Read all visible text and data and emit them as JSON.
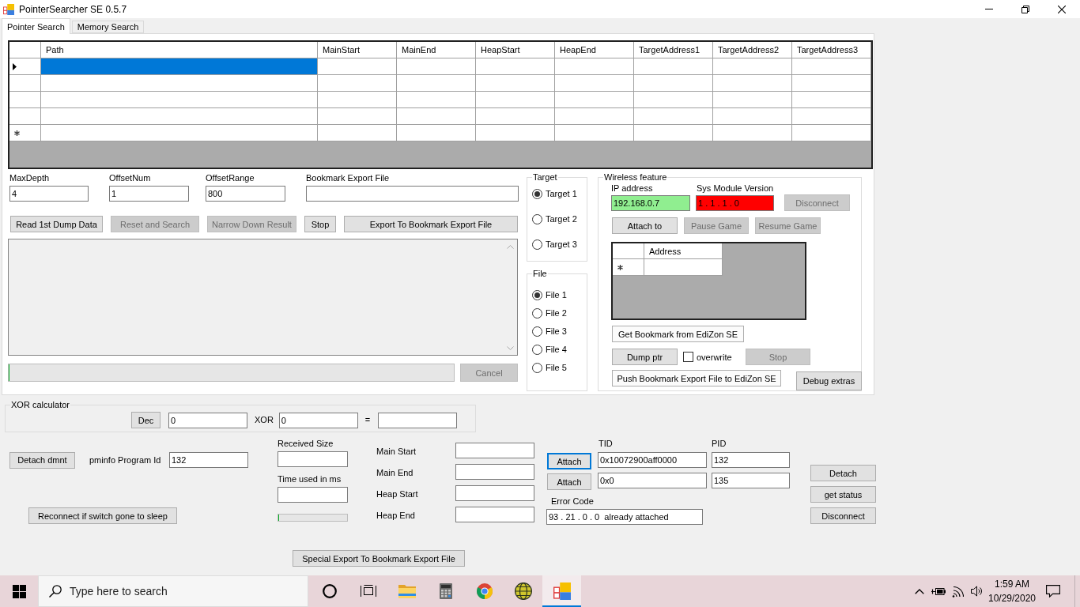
{
  "window": {
    "title": "PointerSearcher SE 0.5.7"
  },
  "tabs": [
    {
      "label": "Pointer Search",
      "selected": true
    },
    {
      "label": "Memory Search",
      "selected": false
    }
  ],
  "results_table": {
    "columns": [
      "Path",
      "MainStart",
      "MainEnd",
      "HeapStart",
      "HeapEnd",
      "TargetAddress1",
      "TargetAddress2",
      "TargetAddress3"
    ],
    "rows": [
      {
        "kind": "data",
        "current": true,
        "selected": true
      },
      {
        "kind": "data",
        "current": false,
        "selected": false
      },
      {
        "kind": "data",
        "current": false,
        "selected": false
      },
      {
        "kind": "data",
        "current": false,
        "selected": false
      },
      {
        "kind": "new",
        "current": false,
        "selected": false
      }
    ]
  },
  "search_fields": [
    {
      "label": "MaxDepth",
      "value": "4"
    },
    {
      "label": "OffsetNum",
      "value": "1"
    },
    {
      "label": "OffsetRange",
      "value": "800"
    },
    {
      "label": "Bookmark Export File"
    }
  ],
  "search_buttons": [
    {
      "label": "Read 1st Dump Data",
      "disabled": false
    },
    {
      "label": "Reset and Search",
      "disabled": true
    },
    {
      "label": "Narrow Down Result",
      "disabled": true
    },
    {
      "label": "Stop",
      "disabled": false
    },
    {
      "label": "Export To Bookmark Export File",
      "disabled": false
    }
  ],
  "search_progress": {
    "level": 0
  },
  "cancel_button": {
    "label": "Cancel",
    "disabled": true
  },
  "target_group": {
    "title": "Target",
    "options": [
      {
        "label": "Target 1",
        "selected": true
      },
      {
        "label": "Target 2",
        "selected": false
      },
      {
        "label": "Target 3",
        "selected": false
      }
    ]
  },
  "file_group": {
    "title": "File",
    "options": [
      {
        "label": "File 1",
        "selected": true
      },
      {
        "label": "File 2",
        "selected": false
      },
      {
        "label": "File 3",
        "selected": false
      },
      {
        "label": "File 4",
        "selected": false
      },
      {
        "label": "File 5",
        "selected": false
      }
    ]
  },
  "wireless": {
    "title": "Wireless feature",
    "fields": [
      {
        "label": "IP address",
        "value": "192.168.0.7",
        "color": "#90ee90"
      },
      {
        "label": "Sys Module Version",
        "value": "1 . 1 . 1 . 0",
        "color": "#ff0000"
      }
    ],
    "disconnect_button": {
      "label": "Disconnect",
      "disabled": true
    },
    "game_buttons": [
      {
        "label": "Attach to",
        "disabled": false
      },
      {
        "label": "Pause Game",
        "disabled": true
      },
      {
        "label": "Resume Game",
        "disabled": true
      }
    ],
    "address_table": {
      "columns": [
        "Address"
      ],
      "rows": [
        {
          "kind": "new"
        }
      ]
    },
    "get_bookmark_button": {
      "label": "Get Bookmark from EdiZon SE"
    },
    "dump_button": {
      "label": "Dump ptr",
      "disabled": false
    },
    "overwrite": {
      "label": "overwrite",
      "checked": false
    },
    "stop_button": {
      "label": "Stop",
      "disabled": true
    },
    "push_button": {
      "label": "Push Bookmark Export File to EdiZon SE"
    },
    "debug_button": {
      "label": "Debug extras"
    }
  },
  "xor_calculator": {
    "title": "XOR calculator",
    "base_button": "Dec",
    "left_value": "0",
    "operator": "XOR",
    "right_value": "0",
    "equals": "="
  },
  "dmnt": {
    "detach_button": "Detach dmnt",
    "program_id_label": "pminfo Program Id",
    "program_id": "132",
    "reconnect_button": "Reconnect if switch gone to sleep"
  },
  "transfer": {
    "received_label": "Received Size",
    "time_label": "Time used in ms",
    "progress": {
      "level": 0
    }
  },
  "regions": [
    {
      "label": "Main Start"
    },
    {
      "label": "Main End"
    },
    {
      "label": "Heap Start"
    },
    {
      "label": "Heap End"
    }
  ],
  "special_export_button": "Special Export To Bookmark Export File",
  "attach": {
    "tid_label": "TID",
    "pid_label": "PID",
    "rows": [
      {
        "button": "Attach",
        "focused": true,
        "tid": "0x10072900aff0000",
        "pid": "132"
      },
      {
        "button": "Attach",
        "focused": false,
        "tid": "0x0",
        "pid": "135"
      }
    ],
    "error_label": "Error Code",
    "error_value": "93 . 21 . 0 . 0  already attached"
  },
  "connection_buttons": [
    "Detach",
    "get status",
    "Disconnect"
  ],
  "taskbar": {
    "search_placeholder": "Type here to search",
    "apps": [
      {
        "kind": "ring",
        "active": false
      },
      {
        "kind": "task_view",
        "active": false
      },
      {
        "kind": "folder",
        "active": false
      },
      {
        "kind": "calculator",
        "active": false
      },
      {
        "kind": "round_logo",
        "active": false
      },
      {
        "kind": "globe",
        "active": false
      },
      {
        "kind": "squares",
        "active": true
      }
    ],
    "time": "1:59 AM",
    "date": "10/29/2020"
  }
}
